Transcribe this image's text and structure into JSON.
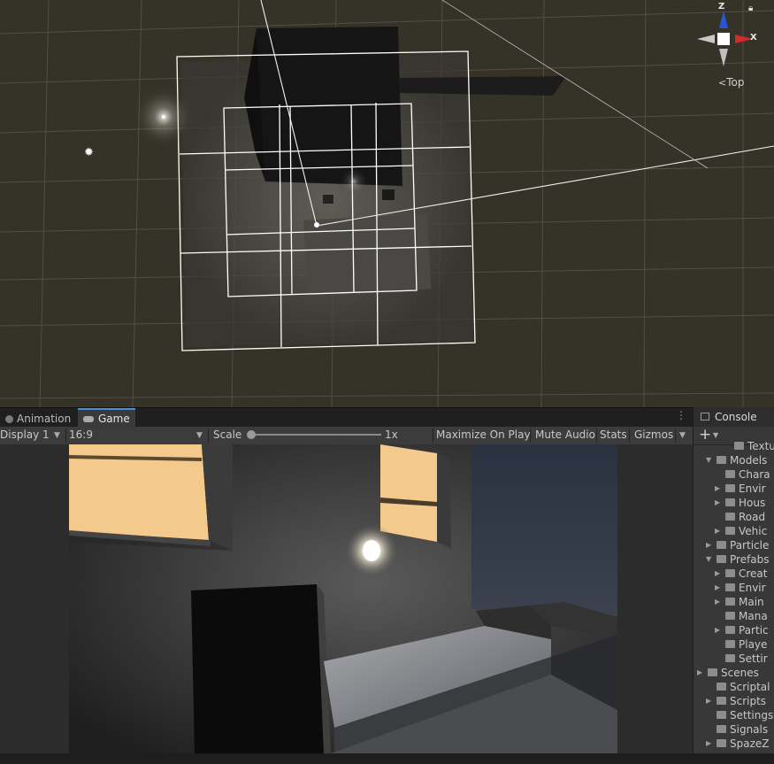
{
  "scene_view": {
    "gizmo": {
      "z_label": "Z",
      "x_label": "X",
      "view_label": "Top"
    }
  },
  "tabs": [
    {
      "label": "Animation",
      "icon": "animation-icon",
      "active": false
    },
    {
      "label": "Game",
      "icon": "game-controller-icon",
      "active": true
    }
  ],
  "game_toolbar": {
    "display": "Display 1",
    "aspect": "16:9",
    "scale_label": "Scale",
    "scale_value": "1x",
    "maximize": "Maximize On Play",
    "mute": "Mute Audio",
    "stats": "Stats",
    "gizmos": "Gizmos"
  },
  "right_panel": {
    "tab_label": "Console",
    "add_label": "+",
    "tree": [
      {
        "label": "Textu",
        "indent": 3,
        "expanded": null
      },
      {
        "label": "Models",
        "indent": 1,
        "expanded": true
      },
      {
        "label": "Chara",
        "indent": 2,
        "expanded": null
      },
      {
        "label": "Envir",
        "indent": 2,
        "expanded": false
      },
      {
        "label": "Hous",
        "indent": 2,
        "expanded": false
      },
      {
        "label": "Road",
        "indent": 2,
        "expanded": null
      },
      {
        "label": "Vehic",
        "indent": 2,
        "expanded": false
      },
      {
        "label": "Particle",
        "indent": 1,
        "expanded": false
      },
      {
        "label": "Prefabs",
        "indent": 1,
        "expanded": true
      },
      {
        "label": "Creat",
        "indent": 2,
        "expanded": false
      },
      {
        "label": "Envir",
        "indent": 2,
        "expanded": false
      },
      {
        "label": "Main",
        "indent": 2,
        "expanded": false
      },
      {
        "label": "Mana",
        "indent": 2,
        "expanded": null
      },
      {
        "label": "Partic",
        "indent": 2,
        "expanded": false
      },
      {
        "label": "Playe",
        "indent": 2,
        "expanded": null
      },
      {
        "label": "Settir",
        "indent": 2,
        "expanded": null
      },
      {
        "label": "Scenes",
        "indent": 0,
        "expanded": false
      },
      {
        "label": "Scriptal",
        "indent": 1,
        "expanded": null
      },
      {
        "label": "Scripts",
        "indent": 1,
        "expanded": false
      },
      {
        "label": "Settings",
        "indent": 1,
        "expanded": null
      },
      {
        "label": "Signals",
        "indent": 1,
        "expanded": null
      },
      {
        "label": "SpazeZ",
        "indent": 1,
        "expanded": false
      }
    ]
  },
  "colors": {
    "scene_bg": "#353227",
    "accent": "#4a8fd9",
    "gizmo_x": "#d22a2a",
    "gizmo_z": "#2956d6",
    "window_glow": "#f4c98c"
  }
}
